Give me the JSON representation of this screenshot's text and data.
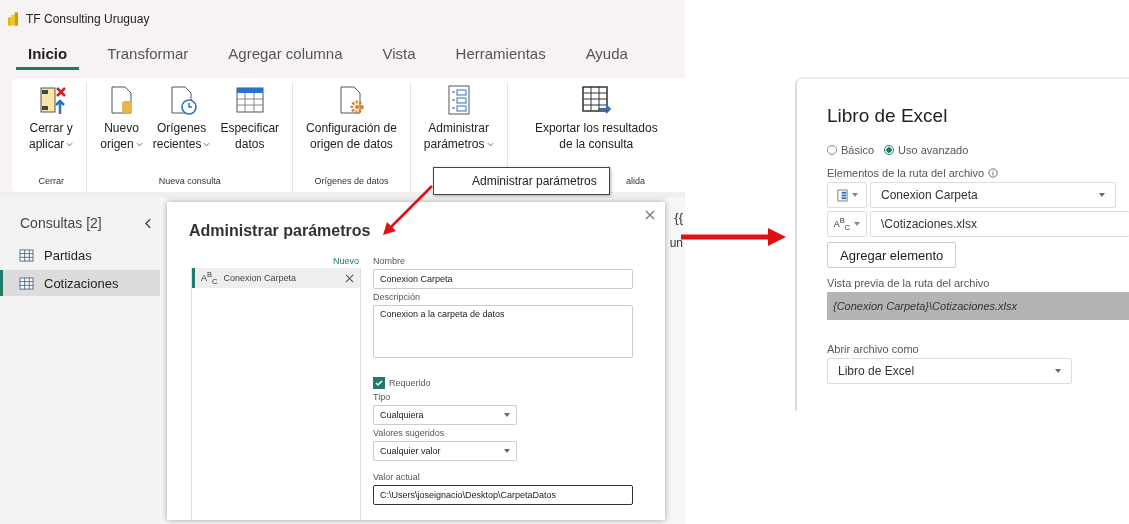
{
  "window": {
    "title": "TF Consulting Uruguay"
  },
  "tabs": [
    {
      "label": "Inicio",
      "selected": true
    },
    {
      "label": "Transformar",
      "selected": false
    },
    {
      "label": "Agregar columna",
      "selected": false
    },
    {
      "label": "Vista",
      "selected": false
    },
    {
      "label": "Herramientas",
      "selected": false
    },
    {
      "label": "Ayuda",
      "selected": false
    }
  ],
  "ribbon": {
    "groups": [
      {
        "label": "Cerrar",
        "buttons": [
          {
            "lines": [
              "Cerrar y",
              "aplicar"
            ],
            "dropdown": true
          }
        ]
      },
      {
        "label": "Nueva consulta",
        "buttons": [
          {
            "lines": [
              "Nuevo",
              "origen"
            ],
            "dropdown": true
          },
          {
            "lines": [
              "Orígenes",
              "recientes"
            ],
            "dropdown": true
          },
          {
            "lines": [
              "Especificar",
              "datos"
            ],
            "dropdown": false
          }
        ]
      },
      {
        "label": "Orígenes de datos",
        "buttons": [
          {
            "lines": [
              "Configuración de",
              "origen de datos"
            ],
            "dropdown": false
          }
        ]
      },
      {
        "buttons": [
          {
            "lines": [
              "Administrar",
              "parámetros"
            ],
            "dropdown": true
          }
        ]
      },
      {
        "label": "alida",
        "buttons": [
          {
            "lines": [
              "Exportar los resultados",
              "de la consulta"
            ],
            "dropdown": false
          }
        ]
      }
    ]
  },
  "dropdown_menu": {
    "items": [
      "Administrar parámetros"
    ]
  },
  "queries": {
    "title": "Consultas [2]",
    "items": [
      {
        "label": "Partidas",
        "selected": false
      },
      {
        "label": "Cotizaciones",
        "selected": true
      }
    ]
  },
  "background_fragments": {
    "formula": "{{",
    "cell": "un"
  },
  "parameters_dialog": {
    "title": "Administrar parámetros",
    "new_link": "Nuevo",
    "parameters": [
      {
        "type_label": "A$^{B}$$_{C}$",
        "name": "Conexion Carpeta",
        "selected": true
      }
    ],
    "name_label": "Nombre",
    "name_value": "Conexion Carpeta",
    "description_label": "Descripción",
    "description_value": "Conexion a la carpeta de datos",
    "required": {
      "label": "Requerido",
      "checked": true
    },
    "type_label": "Tipo",
    "type_value": "Cualquiera",
    "suggested_label": "Valores sugeridos",
    "suggested_value": "Cualquier valor",
    "current_label": "Valor actual",
    "current_value": "C:\\Users\\joseignacio\\Desktop\\CarpetaDatos"
  },
  "excel_dialog": {
    "title": "Libro de Excel",
    "modes": [
      {
        "label": "Básico",
        "selected": false
      },
      {
        "label": "Uso avanzado",
        "selected": true
      }
    ],
    "path_label": "Elementos de la ruta del archivo",
    "path_parts": [
      {
        "kind": "parameter",
        "value": "Conexion Carpeta"
      },
      {
        "kind": "text",
        "type_label": "A$^{B}$$_{C}$",
        "value": "\\Cotizaciones.xlsx"
      }
    ],
    "add_button": "Agregar elemento",
    "preview_label": "Vista previa de la ruta del archivo",
    "preview_value": "{Conexion Carpeta}\\Cotizaciones.xlsx",
    "open_as_label": "Abrir archivo como",
    "open_as_value": "Libro de Excel"
  }
}
